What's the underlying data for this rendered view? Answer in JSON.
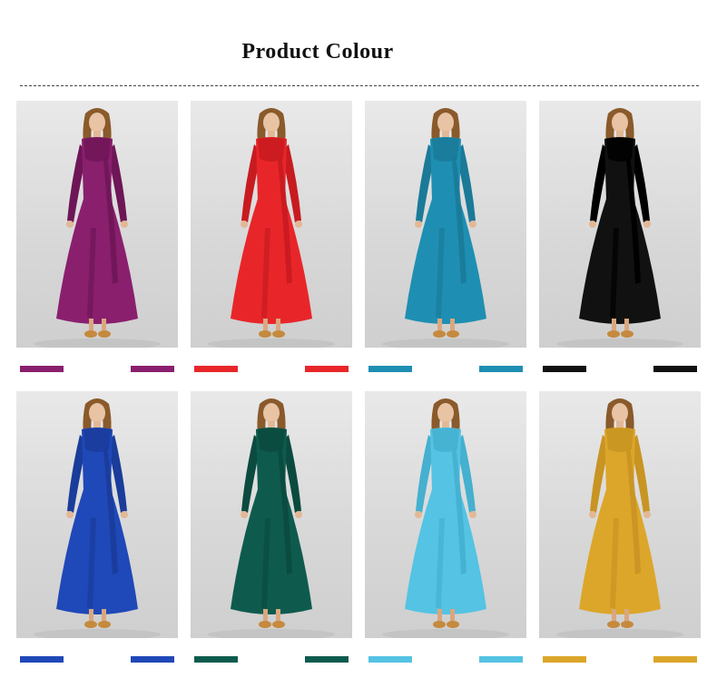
{
  "header": {
    "title": "Product  Colour"
  },
  "products": [
    {
      "color": "#8a1f6e",
      "lace": "#6e1657",
      "image": "purple-dress-photo"
    },
    {
      "color": "#e8262a",
      "lace": "#c81b20",
      "image": "red-dress-photo"
    },
    {
      "color": "#1e8fb2",
      "lace": "#1a7a98",
      "image": "teal-blue-dress-photo"
    },
    {
      "color": "#111111",
      "lace": "#000000",
      "image": "black-dress-photo"
    },
    {
      "color": "#1f48b8",
      "lace": "#1a3c9a",
      "image": "royal-blue-dress-photo"
    },
    {
      "color": "#0e5b4e",
      "lace": "#0b4a3f",
      "image": "dark-green-dress-photo"
    },
    {
      "color": "#55c3e3",
      "lace": "#45b0cf",
      "image": "light-blue-dress-photo"
    },
    {
      "color": "#dca62a",
      "lace": "#c89422",
      "image": "mustard-dress-photo"
    }
  ]
}
